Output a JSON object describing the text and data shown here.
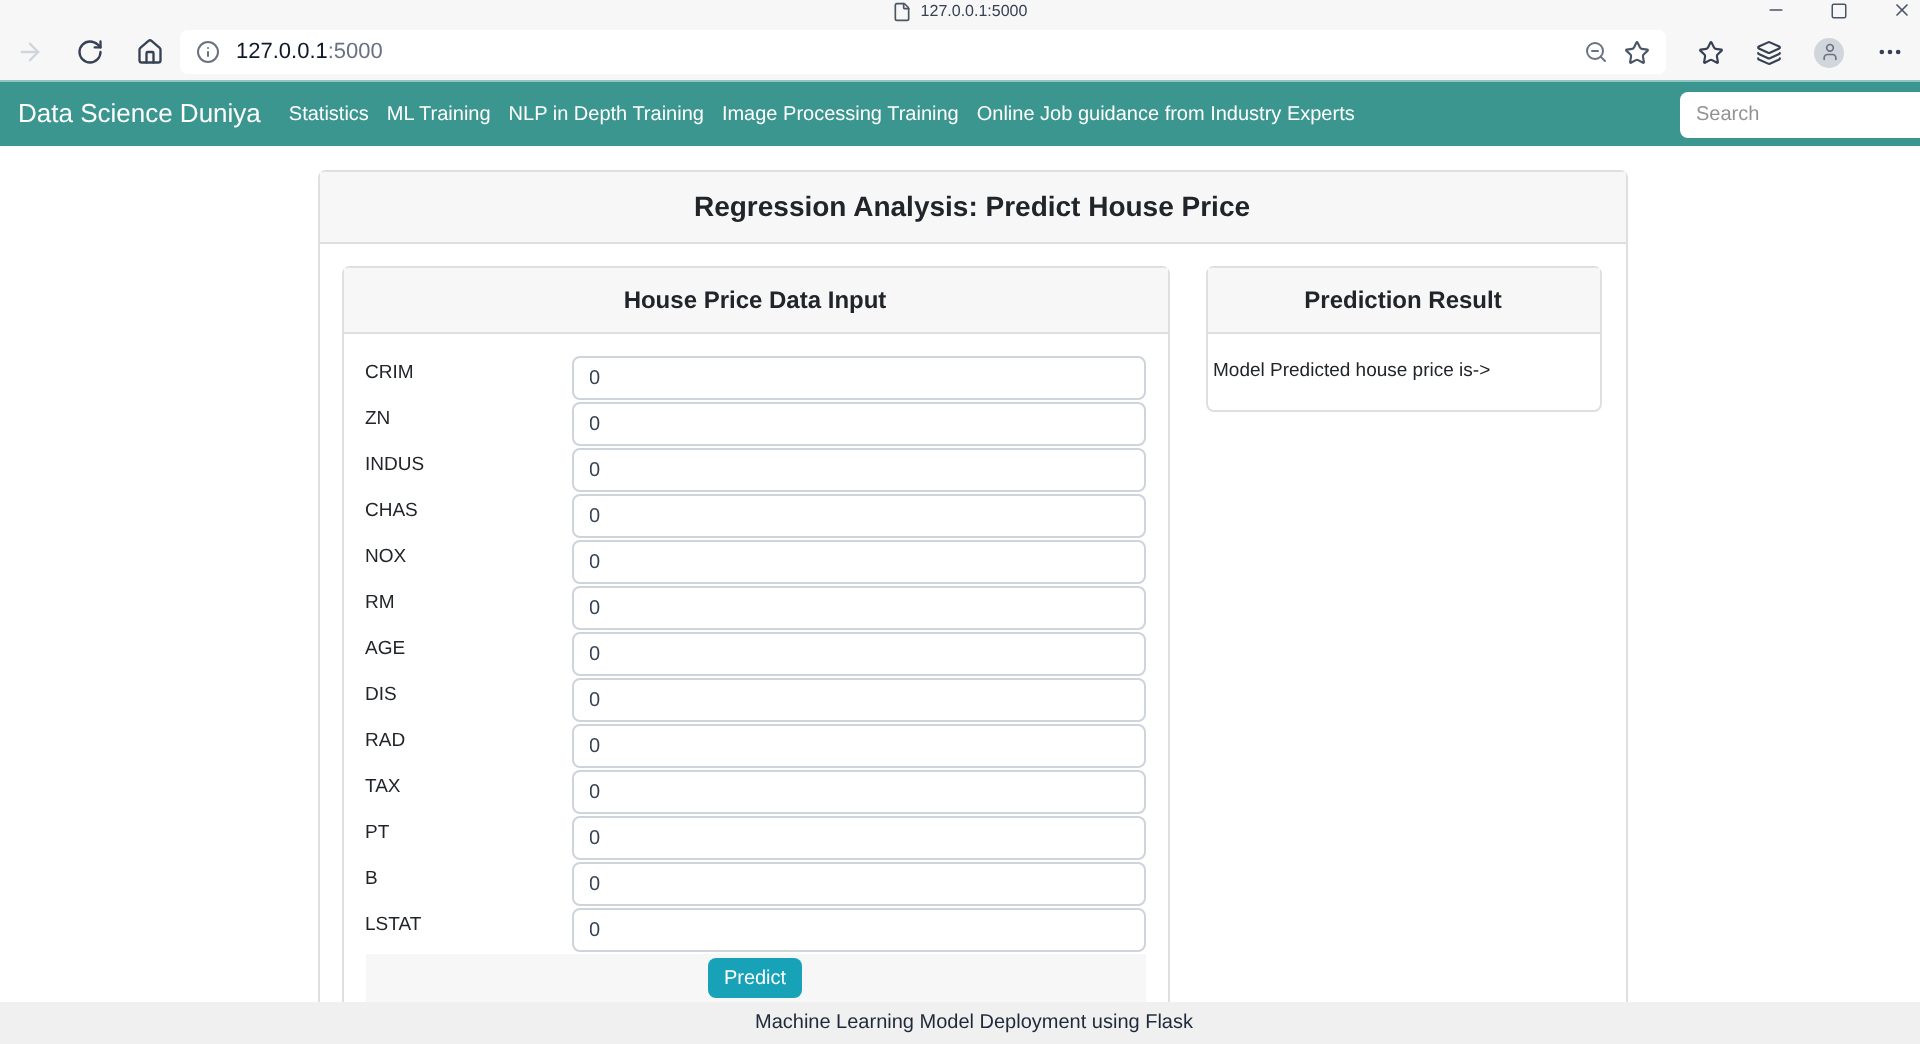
{
  "browser": {
    "tab_title": "127.0.0.1:5000",
    "address_host": "127.0.0.1",
    "address_port": ":5000"
  },
  "navbar": {
    "brand": "Data Science Duniya",
    "links": [
      "Statistics",
      "ML Training",
      "NLP in Depth Training",
      "Image Processing Training",
      "Online Job guidance from Industry Experts"
    ],
    "search": {
      "placeholder": "Search"
    }
  },
  "page": {
    "title": "Regression Analysis: Predict House Price"
  },
  "input_card": {
    "title": "House Price Data Input",
    "fields": [
      {
        "label": "CRIM",
        "value": "0"
      },
      {
        "label": "ZN",
        "value": "0"
      },
      {
        "label": "INDUS",
        "value": "0"
      },
      {
        "label": "CHAS",
        "value": "0"
      },
      {
        "label": "NOX",
        "value": "0"
      },
      {
        "label": "RM",
        "value": "0"
      },
      {
        "label": "AGE",
        "value": "0"
      },
      {
        "label": "DIS",
        "value": "0"
      },
      {
        "label": "RAD",
        "value": "0"
      },
      {
        "label": "TAX",
        "value": "0"
      },
      {
        "label": "PT",
        "value": "0"
      },
      {
        "label": "B",
        "value": "0"
      },
      {
        "label": "LSTAT",
        "value": "0"
      }
    ],
    "button": "Predict"
  },
  "result_card": {
    "title": "Prediction Result",
    "text": "Model Predicted house price is->"
  },
  "footer": "Machine Learning Model Deployment using Flask"
}
